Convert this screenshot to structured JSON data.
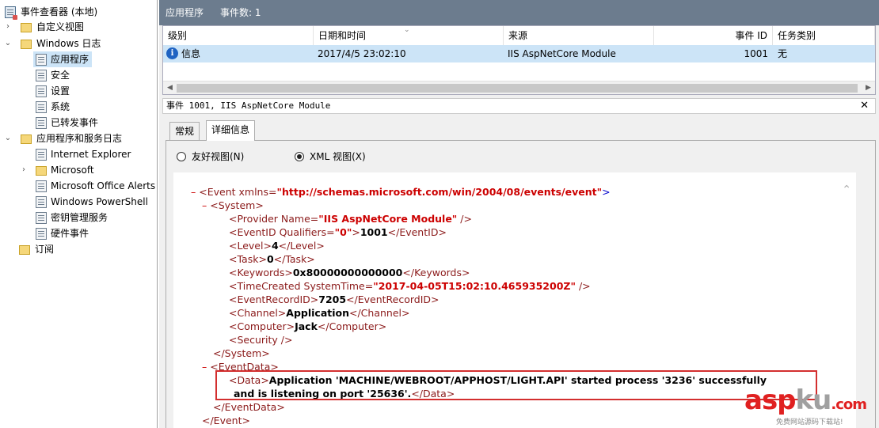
{
  "tree": {
    "root": "事件查看器 (本地)",
    "custom_views": "自定义视图",
    "windows_logs": "Windows 日志",
    "logs": [
      "应用程序",
      "安全",
      "设置",
      "系统",
      "已转发事件"
    ],
    "app_service_logs": "应用程序和服务日志",
    "app_service_items": [
      "Internet Explorer",
      "Microsoft",
      "Microsoft Office Alerts",
      "Windows PowerShell",
      "密钥管理服务",
      "硬件事件"
    ],
    "subscriptions": "订阅"
  },
  "titlebar": {
    "name": "应用程序",
    "count": "事件数: 1"
  },
  "event_list": {
    "columns": [
      "级别",
      "日期和时间",
      "来源",
      "事件 ID",
      "任务类别"
    ],
    "rows": [
      {
        "level": "信息",
        "datetime": "2017/4/5 23:02:10",
        "source": "IIS AspNetCore Module",
        "event_id": "1001",
        "task": "无"
      }
    ]
  },
  "detail": {
    "title": "事件 1001, IIS AspNetCore Module",
    "tabs": [
      "常规",
      "详细信息"
    ],
    "friendly_view": "友好视图(N)",
    "xml_view": "XML 视图(X)"
  },
  "xml": {
    "event_open": "<Event xmlns=",
    "xmlns": "\"http://schemas.microsoft.com/win/2004/08/events/event\"",
    "system_open": "<System>",
    "provider_tag": "<Provider Name=",
    "provider_val": "\"IIS AspNetCore Module\"",
    "provider_close": " />",
    "eventid_tag": "<EventID Qualifiers=",
    "eventid_q": "\"0\"",
    "eventid_val": "1001",
    "eventid_close": "</EventID>",
    "level_val": "4",
    "task_val": "0",
    "keywords_val": "0x80000000000000",
    "timecreated_tag": "<TimeCreated SystemTime=",
    "timecreated_val": "\"2017-04-05T15:02:10.465935200Z\"",
    "eventrecord_val": "7205",
    "channel_val": "Application",
    "computer_val": "Jack",
    "security": "<Security />",
    "system_close": "</System>",
    "eventdata_open": "<EventData>",
    "data_line1": "Application 'MACHINE/WEBROOT/APPHOST/LIGHT.API' started process '3236' successfully",
    "data_line2": "and is listening on port '25636'.",
    "eventdata_close": "</EventData>",
    "event_close": "</Event>"
  },
  "watermark": {
    "brand": "asp",
    "brand_k": "ku",
    "brand_end": ".com",
    "sub": "免费网站源码下载站!"
  },
  "colors": {
    "titlebar": "#6c7c8e",
    "selection": "#cce4f7",
    "highlight_box": "#d32f2f",
    "xml_tag": "#8b1a1a",
    "xml_attr": "#cc0000"
  }
}
